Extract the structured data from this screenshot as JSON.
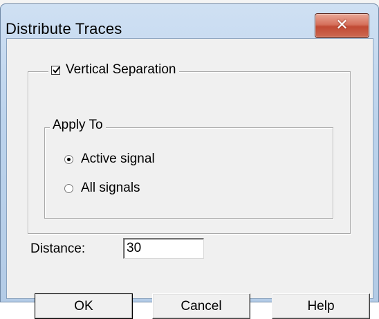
{
  "dialog": {
    "title": "Distribute Traces",
    "close_icon": "x-close-icon"
  },
  "vertical_separation": {
    "label": "Vertical Separation",
    "checked": true
  },
  "apply_to": {
    "label": "Apply To",
    "options": [
      {
        "label": "Active signal",
        "selected": true
      },
      {
        "label": "All signals",
        "selected": false
      }
    ]
  },
  "distance": {
    "label": "Distance:",
    "value": "30"
  },
  "buttons": {
    "ok": "OK",
    "cancel": "Cancel",
    "help": "Help"
  },
  "colors": {
    "title_bar": "#bcd3ec",
    "close_button": "#c14a34",
    "dialog_bg": "#f0f0f0"
  }
}
